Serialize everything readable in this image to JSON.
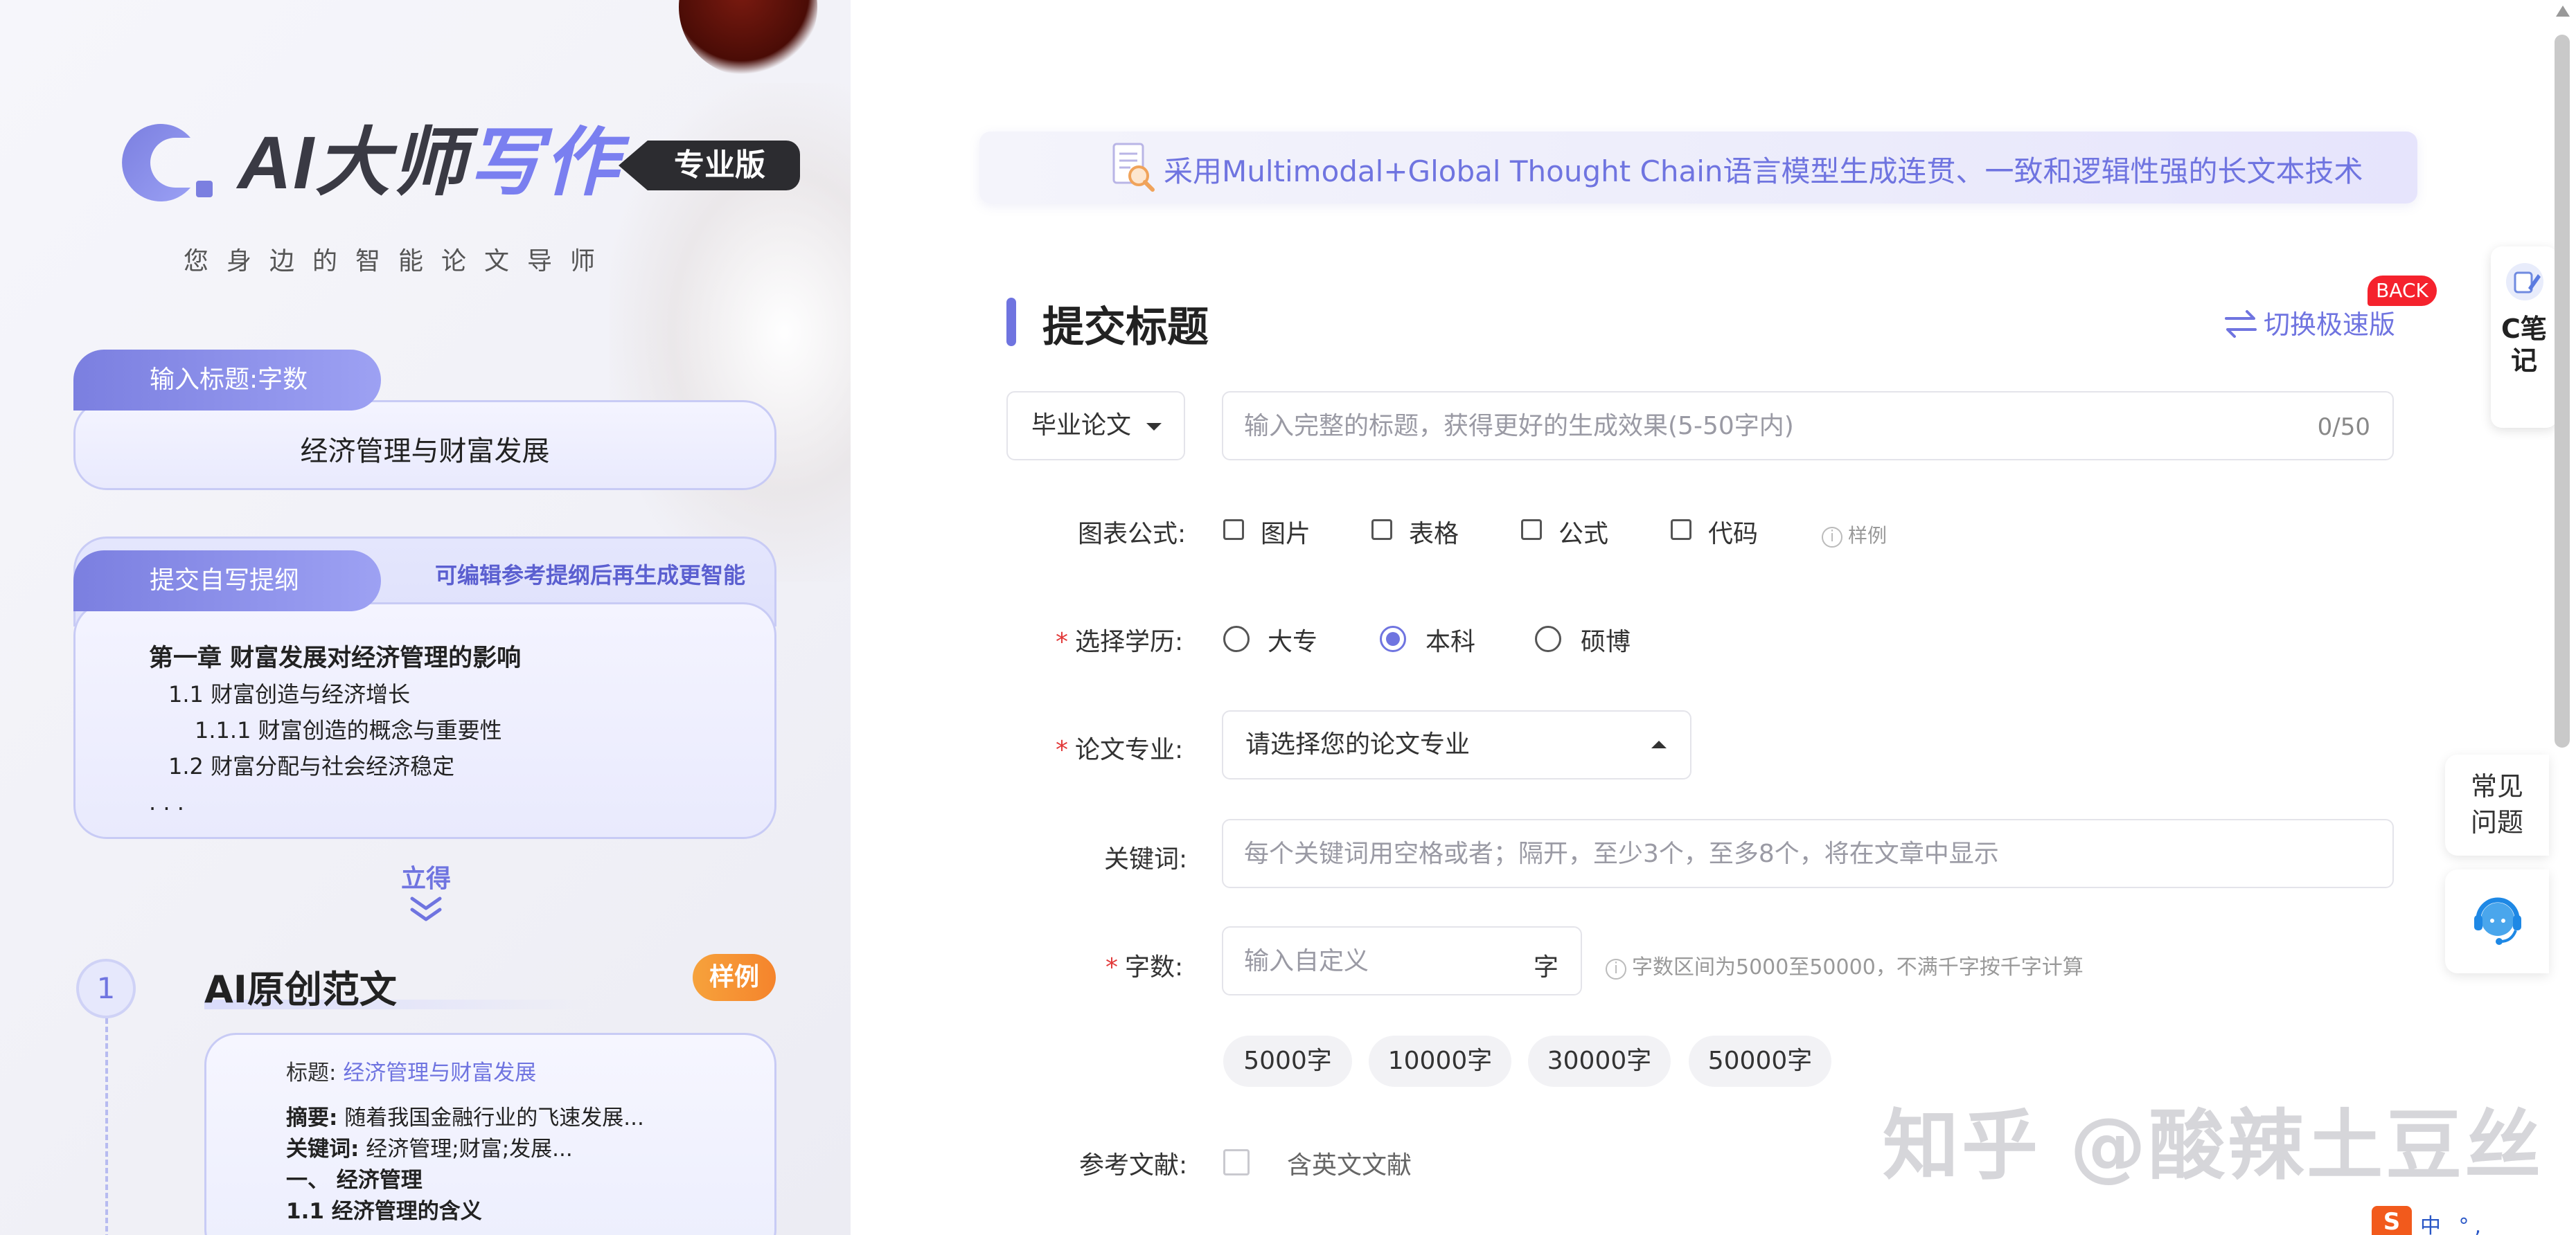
{
  "brand": {
    "logo_text_main": "AI大师",
    "logo_text_accent": "写作",
    "edition_badge": "专业版",
    "slogan": "您身边的智能论文导师"
  },
  "left": {
    "title_card": {
      "tab_label": "输入标题:字数",
      "value": "经济管理与财富发展"
    },
    "outline_card": {
      "tab_label": "提交自写提纲",
      "hint": "可编辑参考提纲后再生成更智能",
      "lines": [
        "第一章 财富发展对经济管理的影响",
        "1.1 财富创造与经济增长",
        "1.1.1 财富创造的概念与重要性",
        "1.2 财富分配与社会经济稳定",
        ". . ."
      ]
    },
    "go_label": "立得",
    "step": {
      "number": "1",
      "title": "AI原创范文",
      "badge": "样例"
    },
    "sample": {
      "title_label": "标题:",
      "title_value": "经济管理与财富发展",
      "abstract_label": "摘要:",
      "abstract_value": "随着我国金融行业的飞速发展...",
      "keywords_label": "关键词:",
      "keywords_value": "经济管理;财富;发展...",
      "section1": "一、 经济管理",
      "section1_1": "1.1 经济管理的含义"
    }
  },
  "main": {
    "banner_text": "采用Multimodal+Global Thought Chain语言模型生成连贯、一致和逻辑性强的长文本技术",
    "section_title": "提交标题",
    "switch_label": "切换极速版",
    "back_badge": "BACK",
    "doc_type": "毕业论文",
    "title_input": {
      "placeholder": "输入完整的标题，获得更好的生成效果(5-50字内)",
      "value": "",
      "counter": "0/50"
    },
    "charts": {
      "label": "图表公式:",
      "options": [
        "图片",
        "表格",
        "公式",
        "代码"
      ],
      "sample_label": "样例"
    },
    "education": {
      "label": "选择学历:",
      "options": [
        "大专",
        "本科",
        "硕博"
      ],
      "selected": "本科"
    },
    "major": {
      "label": "论文专业:",
      "placeholder": "请选择您的论文专业"
    },
    "keywords": {
      "label": "关键词:",
      "placeholder": "每个关键词用空格或者；隔开，至少3个，至多8个，将在文章中显示",
      "value": ""
    },
    "wordcount": {
      "label": "字数:",
      "placeholder": "输入自定义",
      "unit": "字",
      "hint": "字数区间为5000至50000，不满千字按千字计算",
      "presets": [
        "5000字",
        "10000字",
        "30000字",
        "50000字"
      ]
    },
    "references": {
      "label": "参考文献:",
      "option": "含英文文献"
    },
    "watermark": "知乎 @酸辣土豆丝"
  },
  "floaters": {
    "notes_label": "C笔记",
    "faq_label_1": "常见",
    "faq_label_2": "问题"
  },
  "tray": {
    "ime_logo": "S",
    "ime_text": "中 °,"
  },
  "colors": {
    "accent": "#6f74e0",
    "required": "#e23a3a",
    "badge_orange": "#f5842c",
    "back_red": "#f5222d"
  }
}
